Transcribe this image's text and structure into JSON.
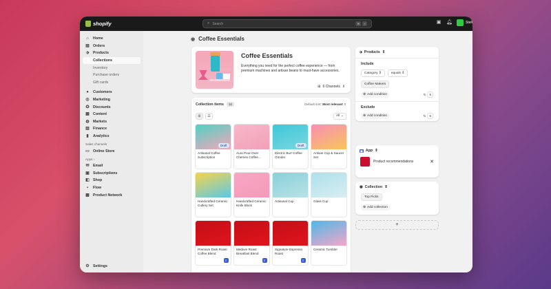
{
  "topbar": {
    "brand": "shopify",
    "search_placeholder": "Search",
    "shortcut_keys": [
      "⌘",
      "K"
    ],
    "store_name": "Stellar",
    "store_avatar_color": "#2ecc40"
  },
  "sidebar": {
    "items": [
      {
        "label": "Home",
        "icon": "home-icon"
      },
      {
        "label": "Orders",
        "icon": "inbox-icon"
      },
      {
        "label": "Products",
        "icon": "tag-icon"
      }
    ],
    "product_subitems": [
      "Collections",
      "Inventory",
      "Purchase orders",
      "Gift cards"
    ],
    "items2": [
      {
        "label": "Customers",
        "icon": "person-icon"
      },
      {
        "label": "Marketing",
        "icon": "target-icon"
      },
      {
        "label": "Discounts",
        "icon": "discount-icon"
      },
      {
        "label": "Content",
        "icon": "content-icon"
      },
      {
        "label": "Markets",
        "icon": "globe-icon"
      },
      {
        "label": "Finance",
        "icon": "bank-icon"
      },
      {
        "label": "Analytics",
        "icon": "chart-icon"
      }
    ],
    "sales_channels_title": "Sales channels",
    "sales_channels": [
      {
        "label": "Online Store",
        "icon": "store-icon"
      }
    ],
    "apps_title": "Apps",
    "apps": [
      {
        "label": "Email",
        "icon": "email-icon"
      },
      {
        "label": "Subscriptions",
        "icon": "subscriptions-icon"
      },
      {
        "label": "Shop",
        "icon": "shop-icon"
      },
      {
        "label": "Flow",
        "icon": "flow-icon"
      },
      {
        "label": "Product Network",
        "icon": "network-icon"
      }
    ],
    "settings": "Settings"
  },
  "page": {
    "title": "Coffee Essentials"
  },
  "hero": {
    "title": "Coffee Essentials",
    "description": "Everything you need for the perfect coffee experience — from premium machines and artisan beans to must-have accessories.",
    "channels": "6 Channels"
  },
  "collection_items": {
    "title": "Collection items",
    "count": "12",
    "sort_label": "Default sort:",
    "sort_value": "Most relevant",
    "filter": "All",
    "draft_label": "Draft",
    "products": [
      {
        "name": "Artisanal Coffee Subscription",
        "draft": true,
        "search": false,
        "color_a": "#4fd1c5",
        "color_b": "#f6a6b8"
      },
      {
        "name": "Aura Pour-Over Chemex Coffee...",
        "draft": false,
        "search": false,
        "color_a": "#f7b8c8",
        "color_b": "#f2a0b8"
      },
      {
        "name": "Electric Burr Coffee Grinder",
        "draft": true,
        "search": false,
        "color_a": "#3ec7d8",
        "color_b": "#7ad6e0"
      },
      {
        "name": "Artisan Cup & Saucer Set",
        "draft": false,
        "search": false,
        "color_a": "#f78fb3",
        "color_b": "#f9c45c"
      },
      {
        "name": "Handcrafted Ceramic Cutlery Set",
        "draft": false,
        "search": false,
        "color_a": "#f6d44a",
        "color_b": "#5bc8e8"
      },
      {
        "name": "Handcrafted Ceramic Knife Block",
        "draft": false,
        "search": false,
        "color_a": "#f7a7c4",
        "color_b": "#f49ab8"
      },
      {
        "name": "Artisanal Cup",
        "draft": false,
        "search": false,
        "color_a": "#8ad0d8",
        "color_b": "#b8e2e6"
      },
      {
        "name": "Glass Cup",
        "draft": false,
        "search": false,
        "color_a": "#aee0ea",
        "color_b": "#d8eef2"
      },
      {
        "name": "Premium Dark Roast Coffee Blend",
        "draft": false,
        "search": true,
        "color_a": "#c40f17",
        "color_b": "#e0141c"
      },
      {
        "name": "Medium Roast Breakfast Blend",
        "draft": false,
        "search": true,
        "color_a": "#c40f17",
        "color_b": "#e0141c"
      },
      {
        "name": "Signature Espresso Roast",
        "draft": false,
        "search": true,
        "color_a": "#c40f17",
        "color_b": "#e0141c"
      },
      {
        "name": "Ceramic Tumbler",
        "draft": false,
        "search": false,
        "color_a": "#4fb8e8",
        "color_b": "#f6a6c8"
      }
    ]
  },
  "products_card": {
    "title": "Products",
    "include_label": "Include",
    "include_field": "Category",
    "include_operator": "equals",
    "include_value": "Coffee Makers",
    "add_condition": "Add condition",
    "include_count": "5",
    "exclude_label": "Exclude",
    "exclude_count": "6"
  },
  "app_card": {
    "title": "App",
    "item": "Product recommendations"
  },
  "collection_card": {
    "title": "Collection",
    "value": "Top Picks",
    "add_collection": "Add collection"
  },
  "add_block_label": "+"
}
